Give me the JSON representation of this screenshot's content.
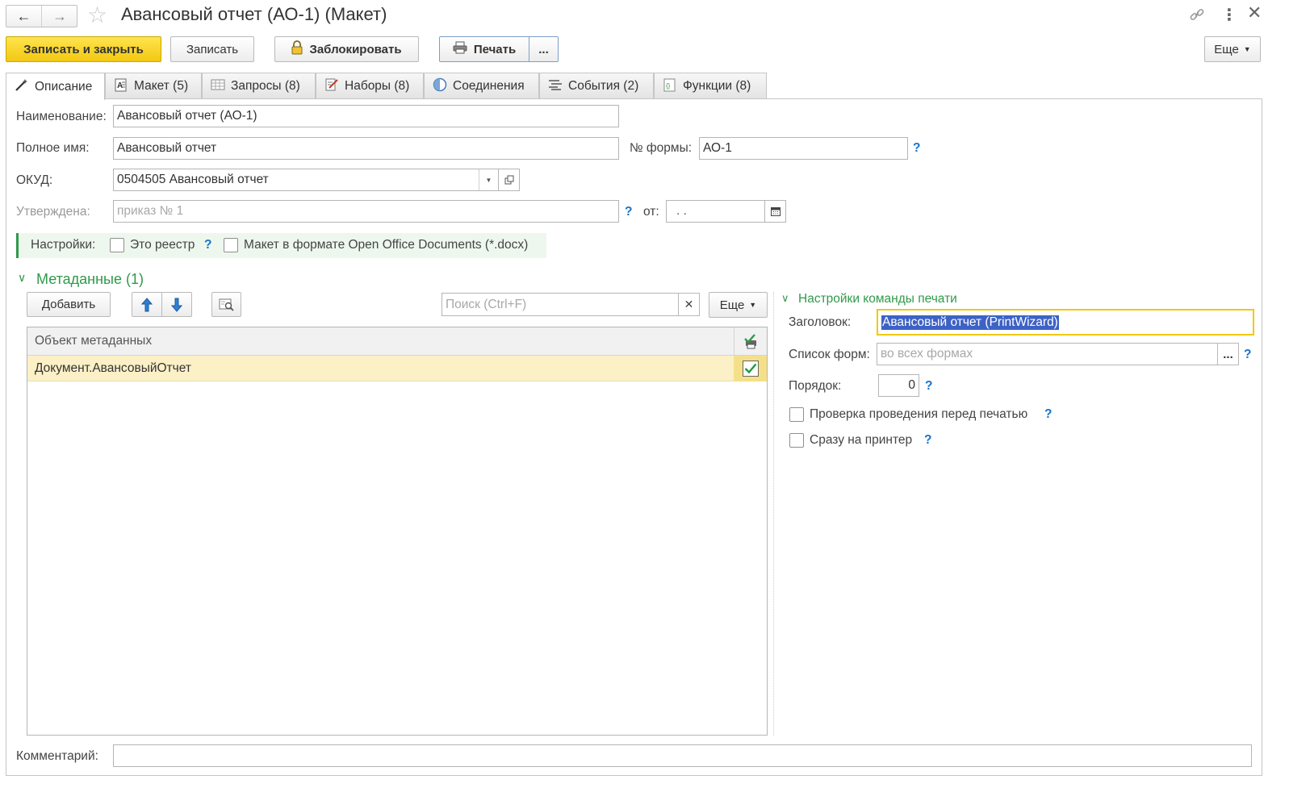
{
  "window": {
    "title": "Авансовый отчет (АО-1) (Макет)"
  },
  "toolbar": {
    "save_close": "Записать и закрыть",
    "save": "Записать",
    "lock": "Заблокировать",
    "print": "Печать",
    "more_dots": "...",
    "more": "Еще"
  },
  "tabs": [
    {
      "label": "Описание"
    },
    {
      "label": "Макет (5)"
    },
    {
      "label": "Запросы (8)"
    },
    {
      "label": "Наборы (8)"
    },
    {
      "label": "Соединения"
    },
    {
      "label": "События (2)"
    },
    {
      "label": "Функции (8)"
    }
  ],
  "form": {
    "name_label": "Наименование:",
    "name_value": "Авансовый отчет (АО-1)",
    "fullname_label": "Полное имя:",
    "fullname_value": "Авансовый отчет",
    "formno_label": "№ формы:",
    "formno_value": "АО-1",
    "okud_label": "ОКУД:",
    "okud_value": "0504505 Авансовый отчет",
    "approved_label": "Утверждена:",
    "approved_placeholder": "приказ № 1",
    "from_label": "от:",
    "from_value": " .  .",
    "settings_label": "Настройки:",
    "registry_label": "Это реестр",
    "docx_label": "Макет в формате Open Office Documents (*.docx)",
    "help": "?"
  },
  "metadata": {
    "header": "Метаданные (1)",
    "add_button": "Добавить",
    "search_placeholder": "Поиск (Ctrl+F)",
    "more": "Еще",
    "column_header": "Объект метаданных",
    "rows": [
      {
        "object": "Документ.АвансовыйОтчет",
        "checked": true
      }
    ]
  },
  "print_settings": {
    "header": "Настройки команды печати",
    "title_label": "Заголовок:",
    "title_value": "Авансовый отчет (PrintWizard)",
    "forms_label": "Список форм:",
    "forms_placeholder": "во всех формах",
    "forms_button": "...",
    "order_label": "Порядок:",
    "order_value": "0",
    "check_posting_label": "Проверка проведения перед печатью",
    "direct_printer_label": "Сразу на принтер"
  },
  "comment": {
    "label": "Комментарий:",
    "value": ""
  },
  "colors": {
    "accent_yellow": "#f2c811",
    "group_green": "#2f9a4a",
    "help_blue": "#1a73c8",
    "selection_blue": "#3d62c6",
    "selected_row": "#fbf0c6"
  }
}
